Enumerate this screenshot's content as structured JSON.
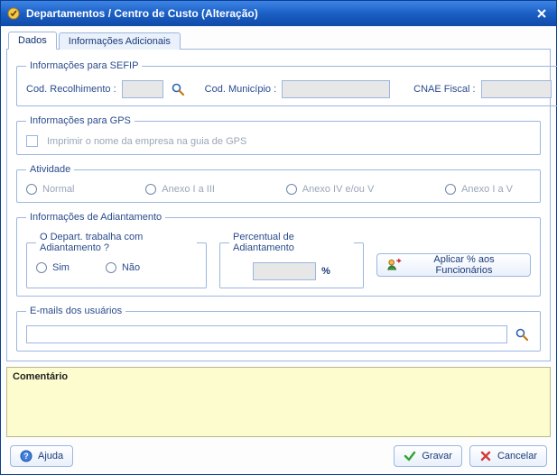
{
  "window": {
    "title": "Departamentos / Centro de Custo (Alteração)"
  },
  "tabs": {
    "dados": "Dados",
    "adicionais": "Informações Adicionais"
  },
  "sefip": {
    "legend": "Informações para SEFIP",
    "cod_recolhimento_label": "Cod. Recolhimento :",
    "cod_recolhimento_value": "",
    "cod_municipio_label": "Cod. Município :",
    "cod_municipio_value": "",
    "cnae_label": "CNAE Fiscal :",
    "cnae_value": ""
  },
  "gps": {
    "legend": "Informações para GPS",
    "print_label": "Imprimir o nome da empresa na guia de GPS"
  },
  "atividade": {
    "legend": "Atividade",
    "options": {
      "normal": "Normal",
      "anexo13": "Anexo I a III",
      "anexo45": "Anexo IV e/ou V",
      "anexo15": "Anexo I a V"
    }
  },
  "adiantamento": {
    "legend": "Informações de Adiantamento",
    "trabalha_legend": "O Depart. trabalha com Adiantamento ?",
    "sim": "Sim",
    "nao": "Não",
    "percentual_legend": "Percentual de Adiantamento",
    "percentual_value": "",
    "percent_symbol": "%",
    "apply_label": "Aplicar % aos Funcionários"
  },
  "emails": {
    "legend": "E-mails dos usuários",
    "value": ""
  },
  "comment": {
    "label": "Comentário"
  },
  "footer": {
    "ajuda": "Ajuda",
    "gravar": "Gravar",
    "cancelar": "Cancelar"
  }
}
